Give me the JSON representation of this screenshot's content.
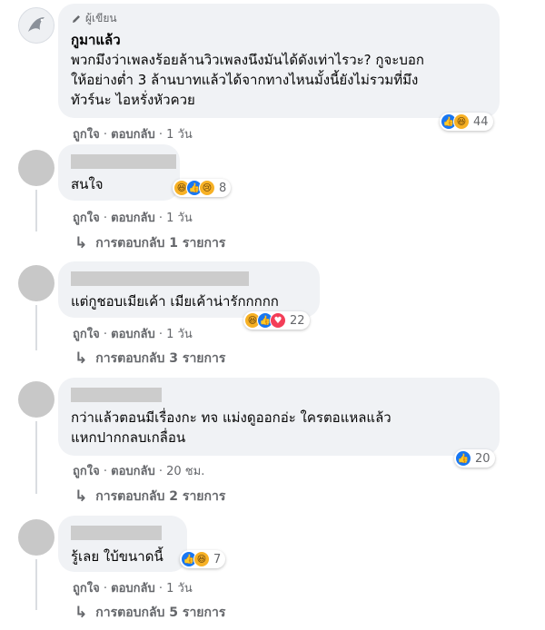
{
  "comments": [
    {
      "badge": "ผู้เขียน",
      "name": "กูมาแล้ว",
      "lines": [
        "พวกมึงว่าเพลงร้อยล้านวิวเพลงนึงมันได้ดังเท่าไรวะ? กูจะบอก",
        "ให้อย่างต่ำ 3 ล้านบาทแล้วได้จากทางไหนมั้งนี้ยังไม่รวมที่มึง",
        "ทัวร์นะ ไอหรั่งหัวควย"
      ],
      "reaction_count": "44",
      "like": "ถูกใจ",
      "reply": "ตอบกลับ",
      "time": "1 วัน"
    },
    {
      "lines": [
        "สนใจ"
      ],
      "reaction_count": "8",
      "like": "ถูกใจ",
      "reply": "ตอบกลับ",
      "time": "1 วัน",
      "replies_label": "การตอบกลับ 1 รายการ"
    },
    {
      "lines": [
        "แต่กูชอบเมียเค้า เมียเค้าน่ารักกกกก"
      ],
      "reaction_count": "22",
      "like": "ถูกใจ",
      "reply": "ตอบกลับ",
      "time": "1 วัน",
      "replies_label": "การตอบกลับ 3 รายการ"
    },
    {
      "lines": [
        "กว่าแล้วตอนมีเรื่องกะ ทจ แม่งดูออกอ่ะ ใครตอแหลแล้ว",
        "แหกปากกลบเกลื่อน"
      ],
      "reaction_count": "20",
      "like": "ถูกใจ",
      "reply": "ตอบกลับ",
      "time": "20 ชม.",
      "replies_label": "การตอบกลับ 2 รายการ"
    },
    {
      "lines": [
        "รู้เลย ใบ้ขนาดนี้"
      ],
      "reaction_count": "7",
      "like": "ถูกใจ",
      "reply": "ตอบกลับ",
      "time": "1 วัน",
      "replies_label": "การตอบกลับ 5 รายการ"
    }
  ],
  "colors": {
    "bubble": "#f0f2f5",
    "meta_text": "#65676b",
    "like_blue": "#1877f2",
    "haha_yellow": "#f7b125",
    "love_red": "#f33e58"
  }
}
